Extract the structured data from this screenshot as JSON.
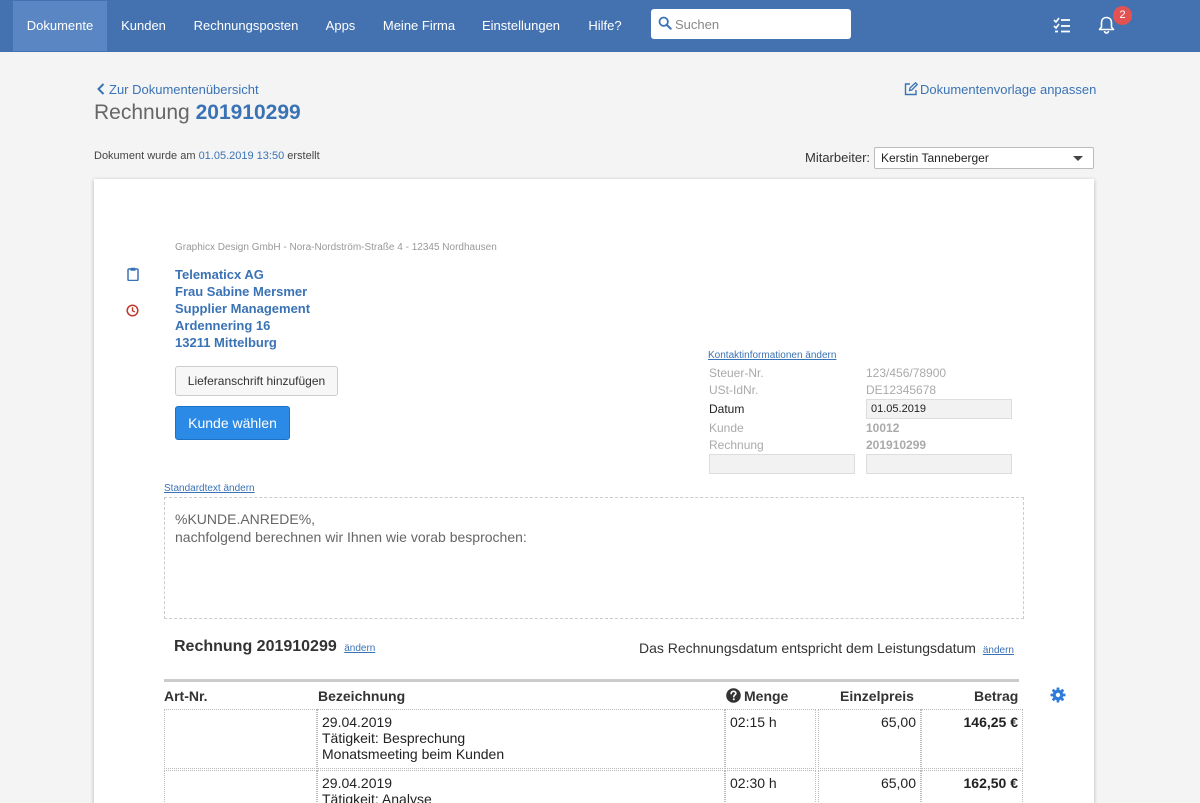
{
  "nav": {
    "items": [
      {
        "label": "Dokumente"
      },
      {
        "label": "Kunden"
      },
      {
        "label": "Rechnungsposten"
      },
      {
        "label": "Apps"
      },
      {
        "label": "Meine Firma"
      },
      {
        "label": "Einstellungen"
      },
      {
        "label": "Hilfe?"
      }
    ],
    "search_placeholder": "Suchen",
    "notification_count": "2"
  },
  "header": {
    "back_link": "Zur Dokumentenübersicht",
    "title_prefix": "Rechnung",
    "title_number": "201910299",
    "template_link": "Dokumentenvorlage anpassen",
    "created_prefix": "Dokument wurde am",
    "created_datetime": "01.05.2019 13:50",
    "created_suffix": "erstellt",
    "employee_label": "Mitarbeiter:",
    "employee_value": "Kerstin Tanneberger"
  },
  "document": {
    "sender_line": "Graphicx Design GmbH - Nora-Nordström-Straße 4 - 12345 Nordhausen",
    "recipient": [
      "Telematicx AG",
      "Frau Sabine Mersmer",
      "Supplier Management",
      "Ardennering 16",
      "13211 Mittelburg"
    ],
    "add_shipping_button": "Lieferanschrift hinzufügen",
    "choose_customer_button": "Kunde wählen",
    "contact_link": "Kontaktinformationen ändern",
    "info": {
      "tax_label": "Steuer-Nr.",
      "tax_value": "123/456/78900",
      "vat_label": "USt-IdNr.",
      "vat_value": "DE12345678",
      "date_label": "Datum",
      "date_value": "01.05.2019",
      "customer_label": "Kunde",
      "customer_value": "10012",
      "invoice_label": "Rechnung",
      "invoice_value": "201910299"
    },
    "standard_text_link": "Standardtext ändern",
    "standard_text_line1": "%KUNDE.ANREDE%,",
    "standard_text_line2": "nachfolgend berechnen wir Ihnen wie vorab besprochen:",
    "invoice_heading": "Rechnung 201910299",
    "change_link": "ändern",
    "date_note": "Das Rechnungsdatum entspricht dem Leistungsdatum",
    "table": {
      "headers": {
        "art": "Art-Nr.",
        "desc": "Bezeichnung",
        "qty": "Menge",
        "unit": "Einzelpreis",
        "total": "Betrag"
      },
      "rows": [
        {
          "art": "",
          "line1": "29.04.2019",
          "line2": "Tätigkeit: Besprechung",
          "line3": "Monatsmeeting beim Kunden",
          "qty": "02:15 h",
          "unit": "65,00",
          "total": "146,25 €"
        },
        {
          "art": "",
          "line1": "29.04.2019",
          "line2": "Tätigkeit: Analyse",
          "line3": "",
          "qty": "02:30 h",
          "unit": "65,00",
          "total": "162,50 €"
        }
      ]
    }
  }
}
